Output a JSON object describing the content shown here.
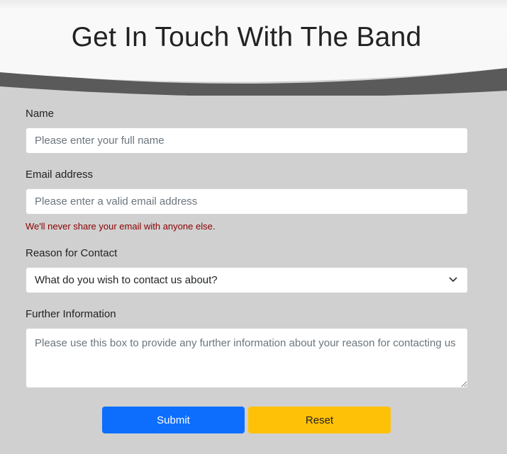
{
  "header": {
    "title": "Get In Touch With The Band"
  },
  "form": {
    "name": {
      "label": "Name",
      "placeholder": "Please enter your full name",
      "value": ""
    },
    "email": {
      "label": "Email address",
      "placeholder": "Please enter a valid email address",
      "value": "",
      "help": "We'll never share your email with anyone else."
    },
    "reason": {
      "label": "Reason for Contact",
      "selected": "What do you wish to contact us about?"
    },
    "info": {
      "label": "Further Information",
      "placeholder": "Please use this box to provide any further information about your reason for contacting us",
      "value": ""
    }
  },
  "buttons": {
    "submit_label": "Submit",
    "reset_label": "Reset"
  },
  "colors": {
    "background": "#d0d0d0",
    "header": "#f8f8f8",
    "header_shadow": "#5a5a5a",
    "submit": "#0d6efd",
    "reset": "#ffc107",
    "help_text": "#8b0000"
  },
  "icons": {
    "select_indicator": "chevron-down-icon"
  }
}
